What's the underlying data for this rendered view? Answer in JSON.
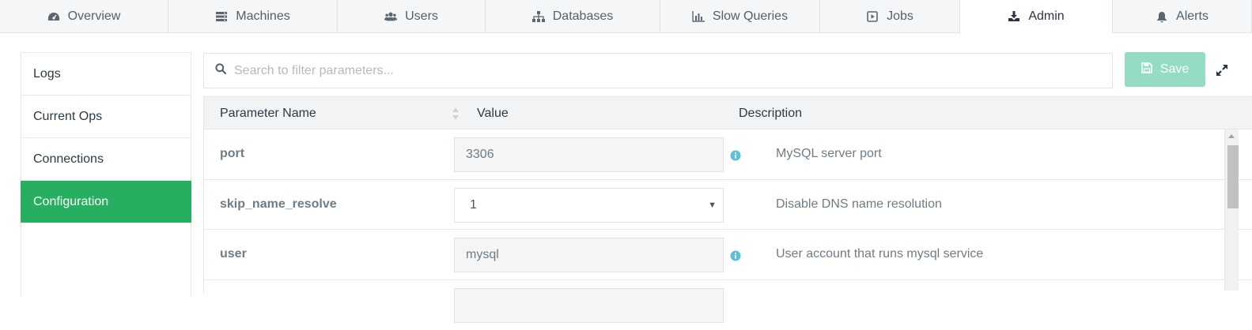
{
  "tabs": [
    {
      "label": "Overview",
      "icon": "dashboard-icon"
    },
    {
      "label": "Machines",
      "icon": "server-icon"
    },
    {
      "label": "Users",
      "icon": "users-icon"
    },
    {
      "label": "Databases",
      "icon": "sitemap-icon"
    },
    {
      "label": "Slow Queries",
      "icon": "bar-chart-icon"
    },
    {
      "label": "Jobs",
      "icon": "play-square-icon"
    },
    {
      "label": "Admin",
      "icon": "download-icon"
    },
    {
      "label": "Alerts",
      "icon": "bell-icon"
    }
  ],
  "active_tab": "Admin",
  "sidebar": {
    "items": [
      {
        "label": "Logs"
      },
      {
        "label": "Current Ops"
      },
      {
        "label": "Connections"
      },
      {
        "label": "Configuration"
      }
    ],
    "active": "Configuration"
  },
  "search": {
    "placeholder": "Search to filter parameters..."
  },
  "toolbar": {
    "save_label": "Save"
  },
  "table": {
    "headers": {
      "name": "Parameter Name",
      "value": "Value",
      "description": "Description"
    },
    "rows": [
      {
        "name": "port",
        "value": "3306",
        "description": "MySQL server port",
        "control": "text",
        "info": true
      },
      {
        "name": "skip_name_resolve",
        "value": "1",
        "description": "Disable DNS name resolution",
        "control": "select",
        "info": false
      },
      {
        "name": "user",
        "value": "mysql",
        "description": "User account that runs mysql service",
        "control": "text",
        "info": true
      }
    ]
  },
  "colors": {
    "accent": "#27ae60",
    "save_disabled": "#94dcc4",
    "info": "#5bc0de"
  }
}
